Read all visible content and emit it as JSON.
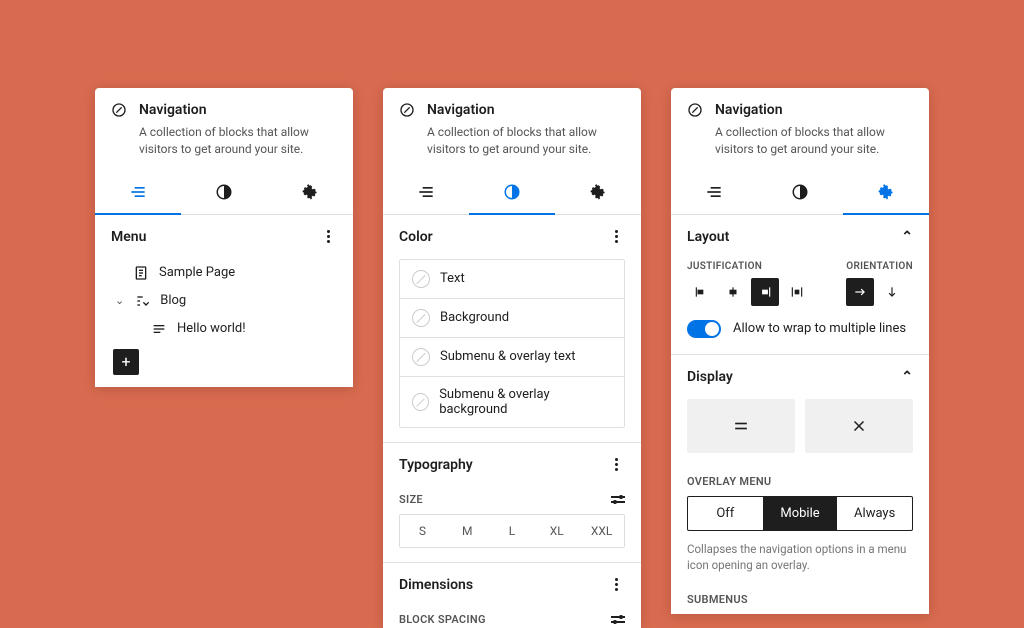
{
  "header": {
    "title": "Navigation",
    "description": "A collection of blocks that allow visitors to get around your site."
  },
  "panel1": {
    "section_title": "Menu",
    "items": [
      {
        "label": "Sample Page",
        "icon": "page-icon",
        "indent": 1
      },
      {
        "label": "Blog",
        "icon": "submenu-icon",
        "indent": 1,
        "expandable": true
      },
      {
        "label": "Hello world!",
        "icon": "post-icon",
        "indent": 2
      }
    ]
  },
  "panel2": {
    "color": {
      "title": "Color",
      "rows": [
        "Text",
        "Background",
        "Submenu & overlay text",
        "Submenu & overlay background"
      ]
    },
    "typography": {
      "title": "Typography",
      "size_label": "SIZE",
      "sizes": [
        "S",
        "M",
        "L",
        "XL",
        "XXL"
      ]
    },
    "dimensions": {
      "title": "Dimensions",
      "spacing_label": "BLOCK SPACING"
    }
  },
  "panel3": {
    "layout": {
      "title": "Layout",
      "justification_label": "JUSTIFICATION",
      "orientation_label": "ORIENTATION",
      "wrap_label": "Allow to wrap to multiple lines",
      "wrap_on": true
    },
    "display": {
      "title": "Display",
      "overlay_menu_label": "OVERLAY MENU",
      "overlay_options": [
        "Off",
        "Mobile",
        "Always"
      ],
      "overlay_selected": "Mobile",
      "overlay_help": "Collapses the navigation options in a menu icon opening an overlay.",
      "submenus_label": "SUBMENUS"
    }
  }
}
